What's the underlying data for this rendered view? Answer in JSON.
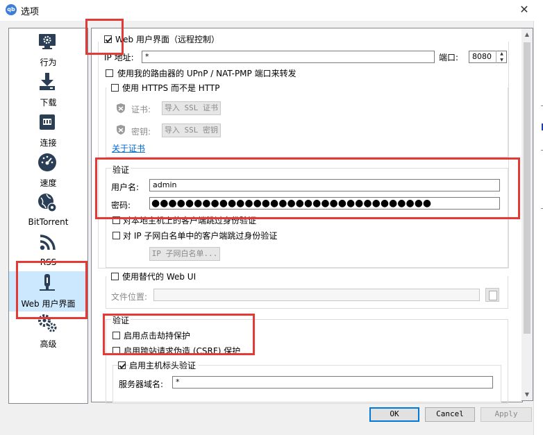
{
  "window": {
    "title": "选项",
    "close": "✕",
    "app_icon_text": "qb"
  },
  "sidebar": {
    "items": [
      {
        "label": "行为",
        "icon": "monitor-gear-icon"
      },
      {
        "label": "下载",
        "icon": "download-icon"
      },
      {
        "label": "连接",
        "icon": "network-icon"
      },
      {
        "label": "速度",
        "icon": "speedometer-icon"
      },
      {
        "label": "BitTorrent",
        "icon": "globe-gear-icon"
      },
      {
        "label": "RSS",
        "icon": "rss-icon"
      },
      {
        "label": "Web 用户界面",
        "icon": "web-ui-icon",
        "selected": true
      },
      {
        "label": "高级",
        "icon": "gears-icon"
      }
    ]
  },
  "webui": {
    "enable_label": "Web 用户界面（远程控制）",
    "enable_checked": true,
    "ip_label": "IP 地址:",
    "ip_value": "*",
    "port_label": "端口:",
    "port_value": "8080",
    "upnp_label": "使用我的路由器的 UPnP / NAT-PMP 端口来转发",
    "https_label": "使用 HTTPS 而不是 HTTP",
    "cert_label": "证书:",
    "cert_button": "导入 SSL 证书",
    "key_label": "密钥:",
    "key_button": "导入 SSL 密钥",
    "about_cert_link": "关于证书"
  },
  "auth": {
    "title": "验证",
    "username_label": "用户名:",
    "username_value": "admin",
    "password_label": "密码:",
    "password_value": "●●●●●●●●●●●●●●●●●●●●●●●●●●●●●●●●●",
    "bypass_local_label": "对本地主机上的客户端跳过身份验证",
    "bypass_whitelist_label": "对 IP 子网白名单中的客户端跳过身份验证",
    "whitelist_button": "IP 子网白名单..."
  },
  "alt_ui": {
    "label": "使用替代的 Web UI",
    "file_location_label": "文件位置:",
    "file_location_value": ""
  },
  "security": {
    "title": "验证",
    "clickjacking_label": "启用点击劫持保护",
    "csrf_label": "启用跨站请求伪造 (CSRF) 保护",
    "host_header_label": "启用主机标头验证",
    "host_header_checked": true,
    "server_domains_label": "服务器域名:",
    "server_domains_value": "*"
  },
  "footer": {
    "ok": "OK",
    "cancel": "Cancel",
    "apply": "Apply"
  },
  "colors": {
    "highlight": "#e53935",
    "selection": "#cce8ff",
    "link": "#0066cc"
  }
}
